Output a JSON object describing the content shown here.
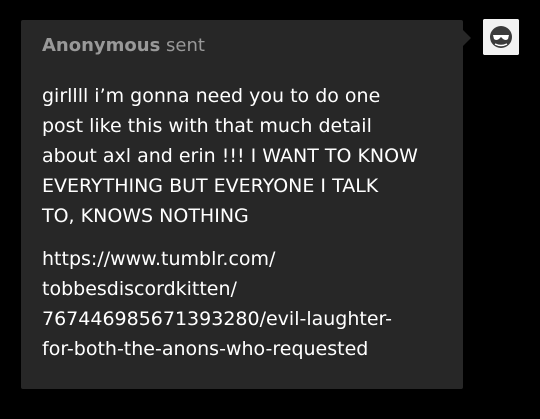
{
  "ask": {
    "sender": "Anonymous",
    "verb": "sent",
    "message_lines": [
      "girllll i’m gonna need you to do one",
      "post like this with that much detail",
      "about axl and erin !!! I WANT TO KNOW",
      "EVERYTHING BUT EVERYONE I TALK",
      "TO, KNOWS NOTHING"
    ],
    "link_lines": [
      "https://www.tumblr.com/",
      "tobbesdiscordkitten/",
      "767446985671393280/evil-laughter-",
      "for-both-the-anons-who-requested"
    ]
  },
  "avatar": {
    "icon": "anonymous-sunglasses-icon"
  },
  "colors": {
    "page_background": "#000000",
    "card_background": "#272727",
    "header_text": "#999999",
    "body_text": "#ffffff"
  }
}
